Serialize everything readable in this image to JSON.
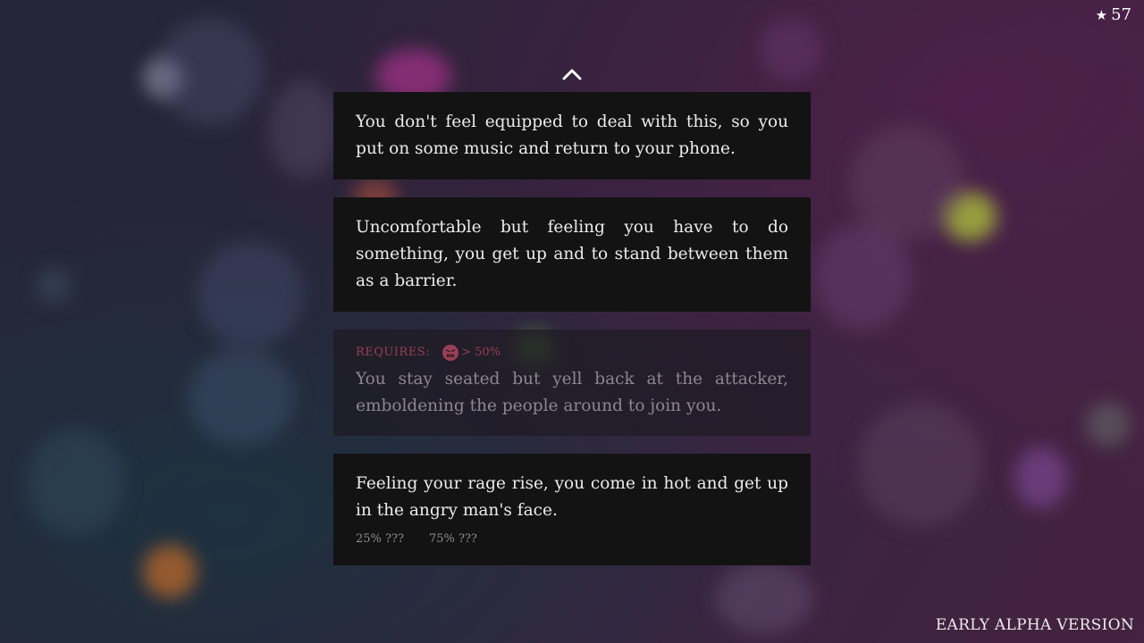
{
  "hud": {
    "star_icon": "star-icon",
    "star_count": "57"
  },
  "scroll_up_icon": "chevron-up-icon",
  "choices": [
    {
      "text": "You don't feel equipped to deal with this, so you put on some music and return to your phone."
    },
    {
      "text": "Uncomfortable but feeling you have to do something, you get up and to stand between them as a barrier."
    },
    {
      "locked": true,
      "requires_label": "REQUIRES:",
      "requires_icon": "rage-face-icon",
      "requires_value": "> 50%",
      "text": "You stay seated but yell back at the attacker, emboldening the people around to join you."
    },
    {
      "text": "Feeling your rage rise, you come in hot and get up in the angry man's face.",
      "outcomes": [
        "25% ???",
        "75% ???"
      ]
    }
  ],
  "version_label": "EARLY ALPHA VERSION",
  "colors": {
    "card_bg": "#131313",
    "requires_accent": "#9a3f55",
    "text": "#ececec"
  }
}
